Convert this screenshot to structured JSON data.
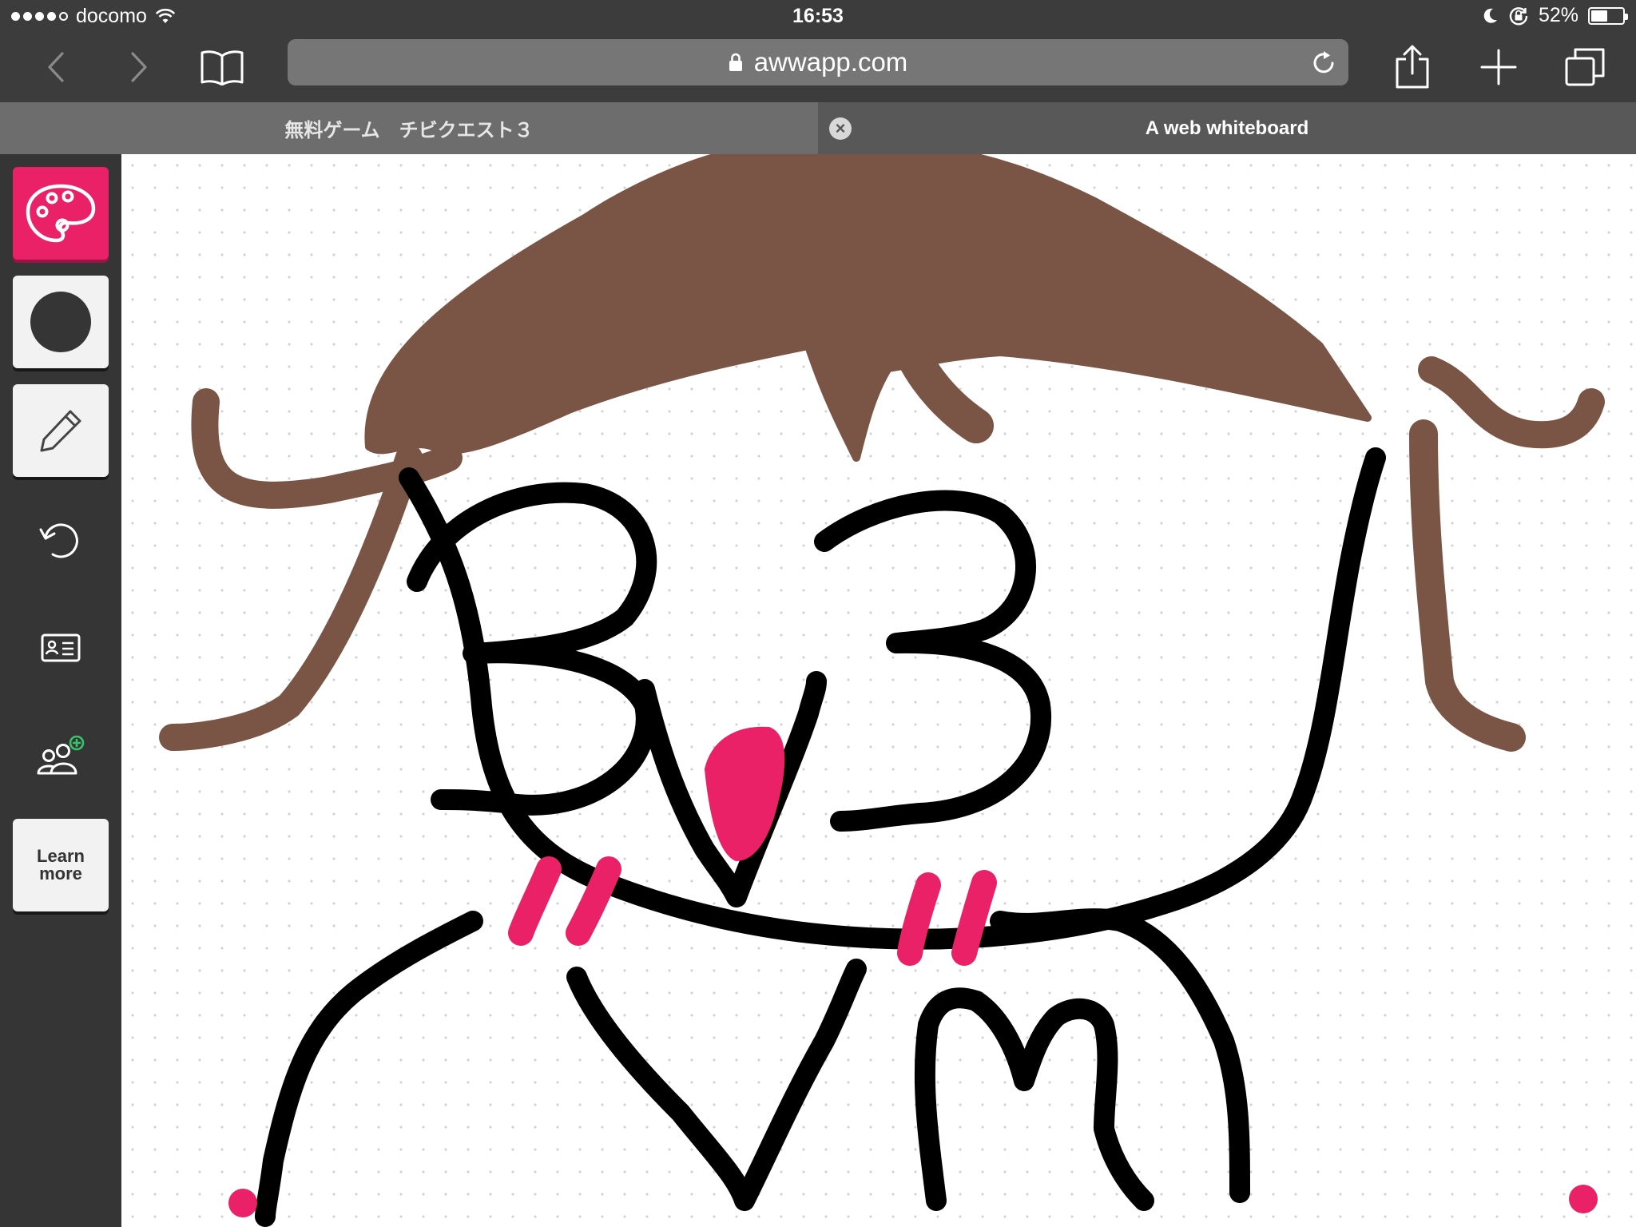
{
  "status_bar": {
    "carrier": "docomo",
    "time": "16:53",
    "battery_percent": "52%",
    "battery_level": 0.52,
    "signal_bars_filled": 4,
    "signal_bars_total": 5,
    "icons": [
      "wifi-icon",
      "do-not-disturb-moon-icon",
      "rotation-lock-icon",
      "battery-icon"
    ]
  },
  "toolbar": {
    "url": "awwapp.com",
    "icons": [
      "back-chevron-icon",
      "forward-chevron-icon",
      "bookmarks-book-icon",
      "lock-icon",
      "reload-icon",
      "share-icon",
      "plus-icon",
      "tabs-icon"
    ]
  },
  "tabs": [
    {
      "title": "無料ゲーム　チビクエスト３",
      "active": false
    },
    {
      "title": "A web whiteboard",
      "active": true,
      "close_glyph": "×"
    }
  ],
  "sidebar": {
    "learn_more_line1": "Learn",
    "learn_more_line2": "more",
    "icons": [
      "palette-icon",
      "brush-size-dot-icon",
      "pencil-icon",
      "undo-icon",
      "board-info-card-icon",
      "invite-users-icon"
    ]
  },
  "colors": {
    "accent_pink": "#ea2166",
    "hair_brown": "#7a5445",
    "ink_black": "#000000",
    "toolbar_dark": "#3c3c3c",
    "sidebar_dark": "#353535"
  }
}
